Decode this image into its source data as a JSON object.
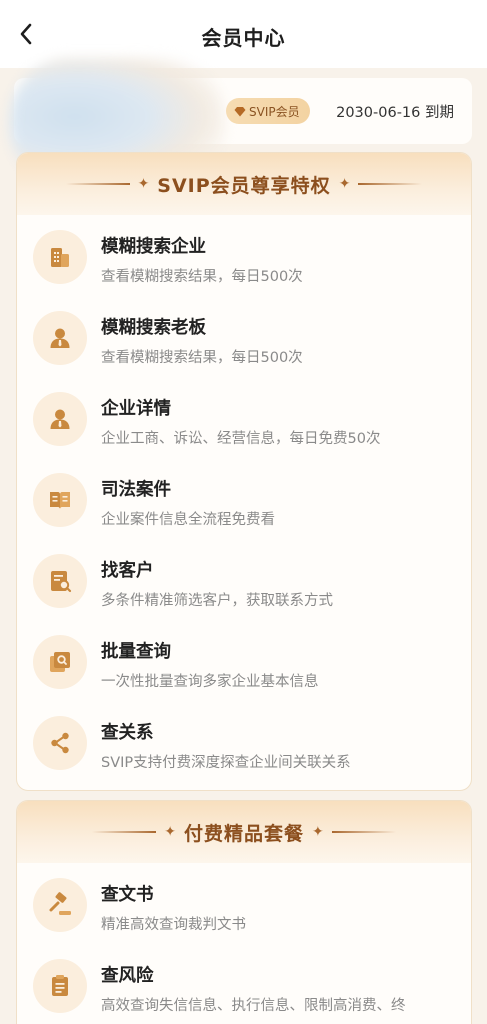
{
  "nav": {
    "title": "会员中心"
  },
  "member": {
    "badge": "SVIP会员",
    "expire": "2030-06-16 到期"
  },
  "privileges": {
    "title": "SVIP会员尊享特权",
    "items": [
      {
        "title": "模糊搜索企业",
        "desc": "查看模糊搜索结果，每日500次",
        "icon": "building-icon"
      },
      {
        "title": "模糊搜索老板",
        "desc": "查看模糊搜索结果，每日500次",
        "icon": "person-icon"
      },
      {
        "title": "企业详情",
        "desc": "企业工商、诉讼、经营信息，每日免费50次",
        "icon": "person-icon"
      },
      {
        "title": "司法案件",
        "desc": "企业案件信息全流程免费看",
        "icon": "book-icon"
      },
      {
        "title": "找客户",
        "desc": "多条件精准筛选客户，获取联系方式",
        "icon": "document-search-icon"
      },
      {
        "title": "批量查询",
        "desc": "一次性批量查询多家企业基本信息",
        "icon": "batch-search-icon"
      },
      {
        "title": "查关系",
        "desc": "SVIP支持付费深度探查企业间关联关系",
        "icon": "share-icon"
      }
    ]
  },
  "packages": {
    "title": "付费精品套餐",
    "items": [
      {
        "title": "查文书",
        "desc": "精准高效查询裁判文书",
        "icon": "gavel-icon"
      },
      {
        "title": "查风险",
        "desc": "高效查询失信信息、执行信息、限制高消费、终",
        "icon": "risk-clipboard-icon"
      }
    ]
  },
  "colors": {
    "accent": "#a9682f",
    "accentDark": "#8c4f1e",
    "iconBg": "#fbeedd",
    "pageBg": "#f8f2ea"
  }
}
